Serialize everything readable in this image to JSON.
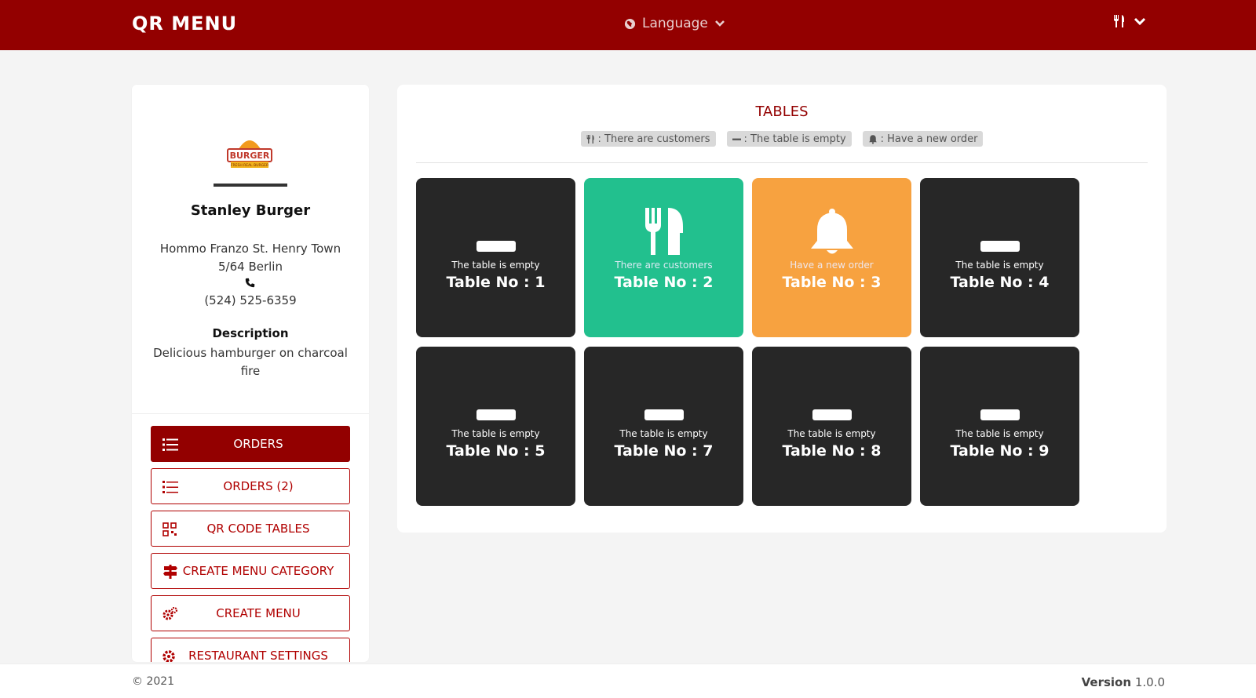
{
  "header": {
    "brand": "QR MENU",
    "language_label": "Language",
    "icons": {
      "language": "globe-icon",
      "user": "utensils-icon",
      "dropdown": "chevron-down-icon"
    }
  },
  "restaurant": {
    "name": "Stanley Burger",
    "address": "Hommo Franzo St. Henry Town 5/64 Berlin",
    "phone": "(524) 525-6359",
    "description_title": "Description",
    "description": "Delicious hamburger on charcoal fire",
    "logo_icon": "burger-logo"
  },
  "nav": {
    "orders": "ORDERS",
    "orders_count": "ORDERS (2)",
    "qr_tables": "QR CODE TABLES",
    "create_category": "CREATE MENU CATEGORY",
    "create_menu": "CREATE MENU",
    "settings": "RESTAURANT SETTINGS"
  },
  "tables_panel": {
    "title": "TABLES",
    "legend": {
      "customers": ": There are customers",
      "empty": ": The table is empty",
      "order": ": Have a new order"
    },
    "tables": [
      {
        "status": "The table is empty",
        "label": "Table No : 1",
        "state": "empty"
      },
      {
        "status": "There are customers",
        "label": "Table No : 2",
        "state": "customers"
      },
      {
        "status": "Have a new order",
        "label": "Table No : 3",
        "state": "order"
      },
      {
        "status": "The table is empty",
        "label": "Table No : 4",
        "state": "empty"
      },
      {
        "status": "The table is empty",
        "label": "Table No : 5",
        "state": "empty"
      },
      {
        "status": "The table is empty",
        "label": "Table No : 7",
        "state": "empty"
      },
      {
        "status": "The table is empty",
        "label": "Table No : 8",
        "state": "empty"
      },
      {
        "status": "The table is empty",
        "label": "Table No : 9",
        "state": "empty"
      }
    ],
    "colors": {
      "empty": "#272727",
      "customers": "#22c08e",
      "order": "#f7a240"
    }
  },
  "footer": {
    "copyright": "© 2021",
    "version_label": "Version",
    "version_value": "1.0.0"
  },
  "colors": {
    "primary": "#930000",
    "accent_text": "#b00000"
  }
}
